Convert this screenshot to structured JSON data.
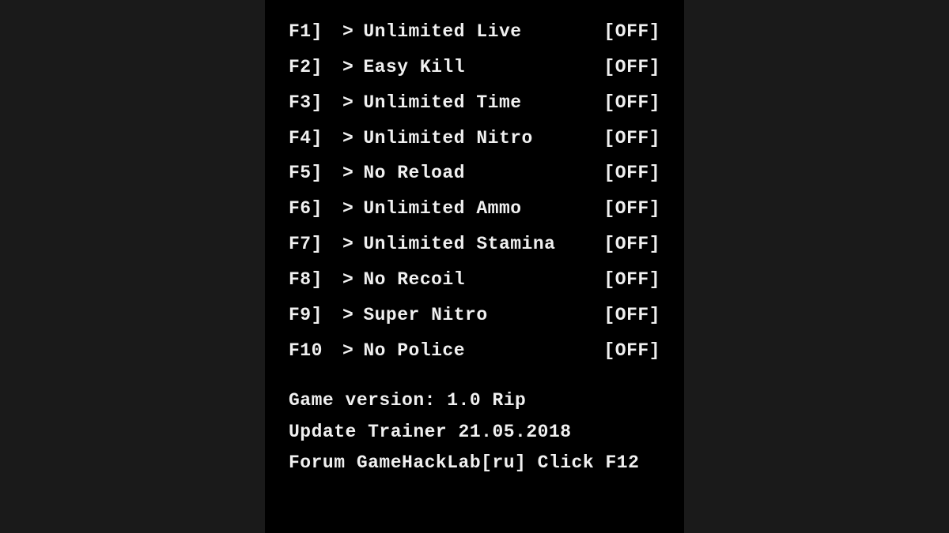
{
  "cheats": [
    {
      "key": "F1]",
      "label": "Unlimited Live",
      "state": "[OFF]"
    },
    {
      "key": "F2]",
      "label": "Easy Kill",
      "state": "[OFF]"
    },
    {
      "key": "F3]",
      "label": "Unlimited Time",
      "state": "[OFF]"
    },
    {
      "key": "F4]",
      "label": "Unlimited Nitro",
      "state": "[OFF]"
    },
    {
      "key": "F5]",
      "label": "No Reload",
      "state": "[OFF]"
    },
    {
      "key": "F6]",
      "label": "Unlimited Ammo",
      "state": "[OFF]"
    },
    {
      "key": "F7]",
      "label": "Unlimited Stamina",
      "state": "[OFF]"
    },
    {
      "key": "F8]",
      "label": "No Recoil",
      "state": "[OFF]"
    },
    {
      "key": "F9]",
      "label": "Super Nitro",
      "state": "[OFF]"
    },
    {
      "key": "F10",
      "label": "No Police",
      "state": "[OFF]"
    }
  ],
  "arrow": ">",
  "footer": {
    "version": "Game version: 1.0 Rip",
    "update": "Update Trainer 21.05.2018",
    "forum": "Forum GameHackLab[ru] Click F12"
  }
}
